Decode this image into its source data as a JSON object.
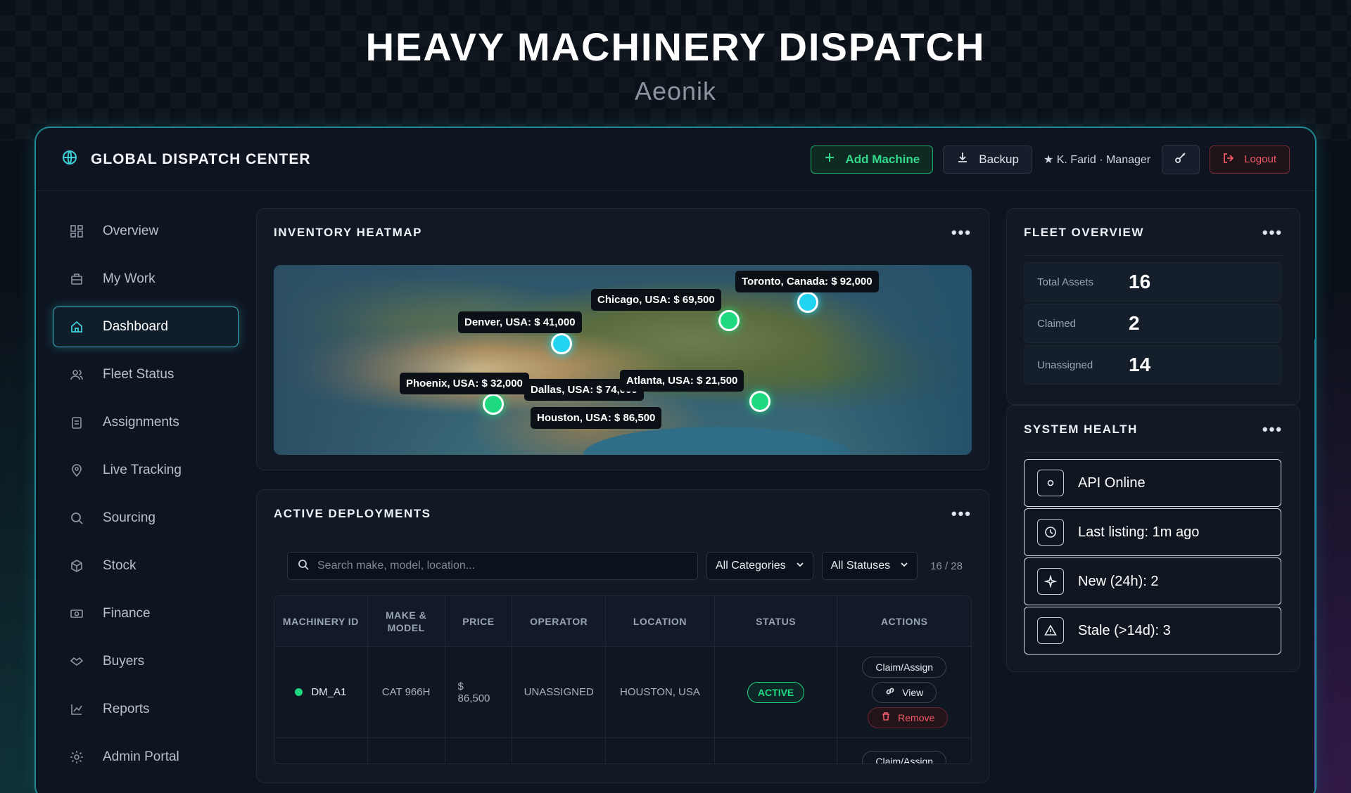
{
  "hero": {
    "title": "HEAVY MACHINERY DISPATCH",
    "subtitle": "Aeonik"
  },
  "topbar": {
    "title": "GLOBAL DISPATCH CENTER",
    "add_label": "Add Machine",
    "backup_label": "Backup",
    "user_label": "★ K. Farid · Manager",
    "logout_label": "Logout"
  },
  "sidebar": {
    "items": [
      {
        "label": "Overview",
        "icon": "grid-icon"
      },
      {
        "label": "My Work",
        "icon": "briefcase-icon"
      },
      {
        "label": "Dashboard",
        "icon": "home-icon",
        "active": true
      },
      {
        "label": "Fleet Status",
        "icon": "users-icon"
      },
      {
        "label": "Assignments",
        "icon": "clipboard-icon"
      },
      {
        "label": "Live Tracking",
        "icon": "map-pin-icon"
      },
      {
        "label": "Sourcing",
        "icon": "search-icon"
      },
      {
        "label": "Stock",
        "icon": "box-icon"
      },
      {
        "label": "Finance",
        "icon": "banknote-icon"
      },
      {
        "label": "Buyers",
        "icon": "handshake-icon"
      },
      {
        "label": "Reports",
        "icon": "chart-icon"
      },
      {
        "label": "Admin Portal",
        "icon": "sun-gear-icon"
      }
    ]
  },
  "heatmap": {
    "title": "INVENTORY HEATMAP",
    "markers": [
      {
        "label": "Toronto, Canada: $ 92,000",
        "color": "cyan"
      },
      {
        "label": "Chicago, USA: $ 69,500",
        "color": "green"
      },
      {
        "label": "Denver, USA: $ 41,000",
        "color": "cyan"
      },
      {
        "label": "Phoenix, USA: $ 32,000",
        "color": "green"
      },
      {
        "label": "Dallas, USA: $ 74,000",
        "color": "cyan"
      },
      {
        "label": "Atlanta, USA: $ 21,500",
        "color": "green"
      },
      {
        "label": "Houston, USA: $ 86,500",
        "color": "green"
      }
    ]
  },
  "deployments": {
    "title": "ACTIVE DEPLOYMENTS",
    "search_placeholder": "Search make, model, location...",
    "category_select": "All Categories",
    "status_select": "All Statuses",
    "count": "16 / 28",
    "columns": [
      "MACHINERY ID",
      "MAKE & MODEL",
      "PRICE",
      "OPERATOR",
      "LOCATION",
      "STATUS",
      "ACTIONS"
    ],
    "rows": [
      {
        "id": "DM_A1",
        "model": "CAT 966H",
        "price_symbol": "$",
        "price": "86,500",
        "operator": "UNASSIGNED",
        "location": "HOUSTON, USA",
        "status": "ACTIVE"
      }
    ],
    "actions": {
      "claim": "Claim/Assign",
      "view": "View",
      "remove": "Remove"
    }
  },
  "fleet": {
    "title": "FLEET OVERVIEW",
    "stats": [
      {
        "label": "Total Assets",
        "value": "16"
      },
      {
        "label": "Claimed",
        "value": "2"
      },
      {
        "label": "Unassigned",
        "value": "14"
      }
    ]
  },
  "health": {
    "title": "SYSTEM HEALTH",
    "items": [
      {
        "label": "API Online",
        "icon": "circle-icon"
      },
      {
        "label": "Last listing: 1m ago",
        "icon": "clock-icon"
      },
      {
        "label": "New (24h): 2",
        "icon": "sparkle-icon"
      },
      {
        "label": "Stale (>14d): 3",
        "icon": "warning-icon"
      }
    ]
  },
  "colors": {
    "accent": "#3ab8c6",
    "success": "#1ed980",
    "danger": "#f05a67",
    "cyan_pin": "#22d4f0"
  }
}
